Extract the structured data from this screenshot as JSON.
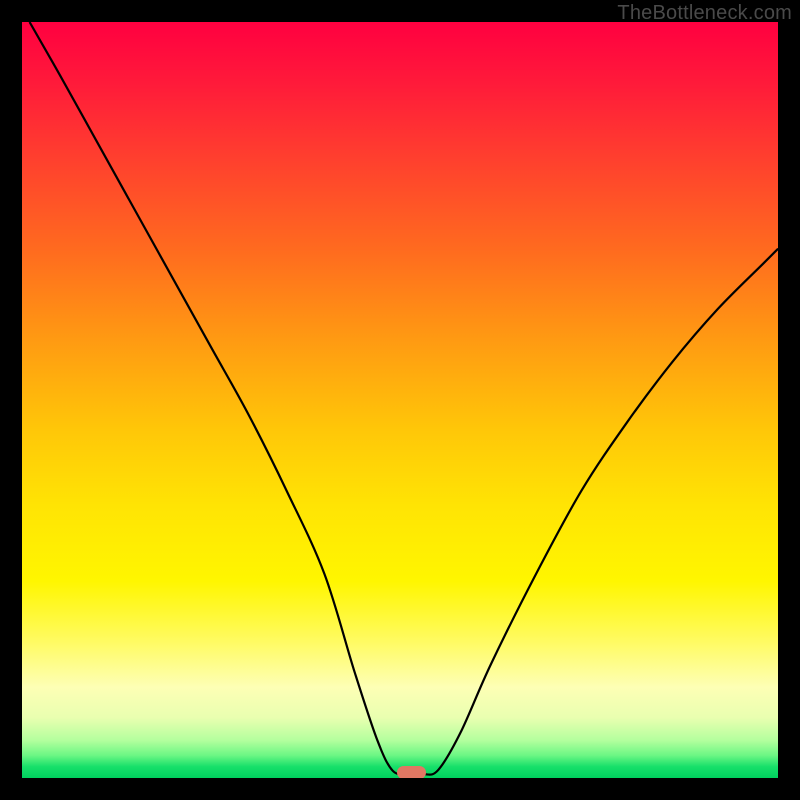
{
  "watermark": "TheBottleneck.com",
  "chart_data": {
    "type": "line",
    "title": "",
    "xlabel": "",
    "ylabel": "",
    "xlim": [
      0,
      100
    ],
    "ylim": [
      0,
      100
    ],
    "grid": false,
    "legend": false,
    "series": [
      {
        "name": "curve",
        "x": [
          1,
          5,
          10,
          15,
          20,
          25,
          30,
          35,
          40,
          44,
          47,
          49,
          51,
          53,
          55,
          58,
          62,
          68,
          74,
          80,
          86,
          92,
          98,
          100
        ],
        "y": [
          100,
          93,
          84,
          75,
          66,
          57,
          48,
          38,
          27,
          14,
          5,
          1,
          0.5,
          0.5,
          1,
          6,
          15,
          27,
          38,
          47,
          55,
          62,
          68,
          70
        ]
      }
    ],
    "marker": {
      "x": 51.5,
      "y": 0.7,
      "width_frac": 0.038,
      "height_frac": 0.018,
      "color": "#e07763"
    },
    "gradient_note": "vertical heat gradient from red (top) through orange/yellow to green (bottom)"
  }
}
